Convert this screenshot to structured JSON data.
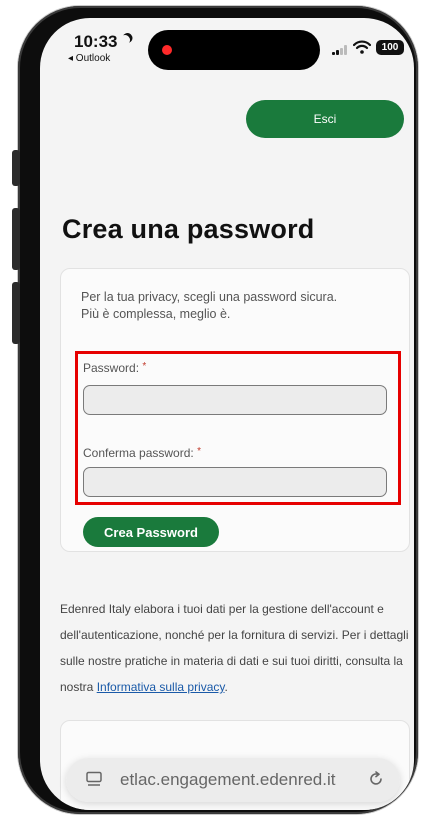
{
  "status_bar": {
    "time": "10:33",
    "back_app": "◂ Outlook",
    "battery": "100"
  },
  "header": {
    "logout_label": "Esci"
  },
  "page": {
    "title": "Crea una password"
  },
  "form": {
    "intro_line1": "Per la tua privacy, scegli una password sicura.",
    "intro_line2": "Più è complessa, meglio è.",
    "password_label": "Password:",
    "confirm_label": "Conferma password:",
    "required_mark": "*",
    "password_value": "",
    "confirm_value": "",
    "submit_label": "Crea Password"
  },
  "disclaimer": {
    "text": "Edenred Italy elabora i tuoi dati per la gestione dell'account e dell'autenticazione, nonché per la fornitura di servizi. Per i dettagli sulle nostre pratiche in materia di dati e sui tuoi diritti, consulta la nostra ",
    "link_label": "Informativa sulla privacy",
    "end": "."
  },
  "browser": {
    "url": "etlac.engagement.edenred.it"
  },
  "colors": {
    "brand_green": "#1a7a3c",
    "highlight_red": "#e60000",
    "link_blue": "#1a5aa8"
  },
  "icons": [
    "moon-icon",
    "signal-icon",
    "wifi-icon",
    "battery-icon",
    "reader-icon",
    "reload-icon"
  ]
}
